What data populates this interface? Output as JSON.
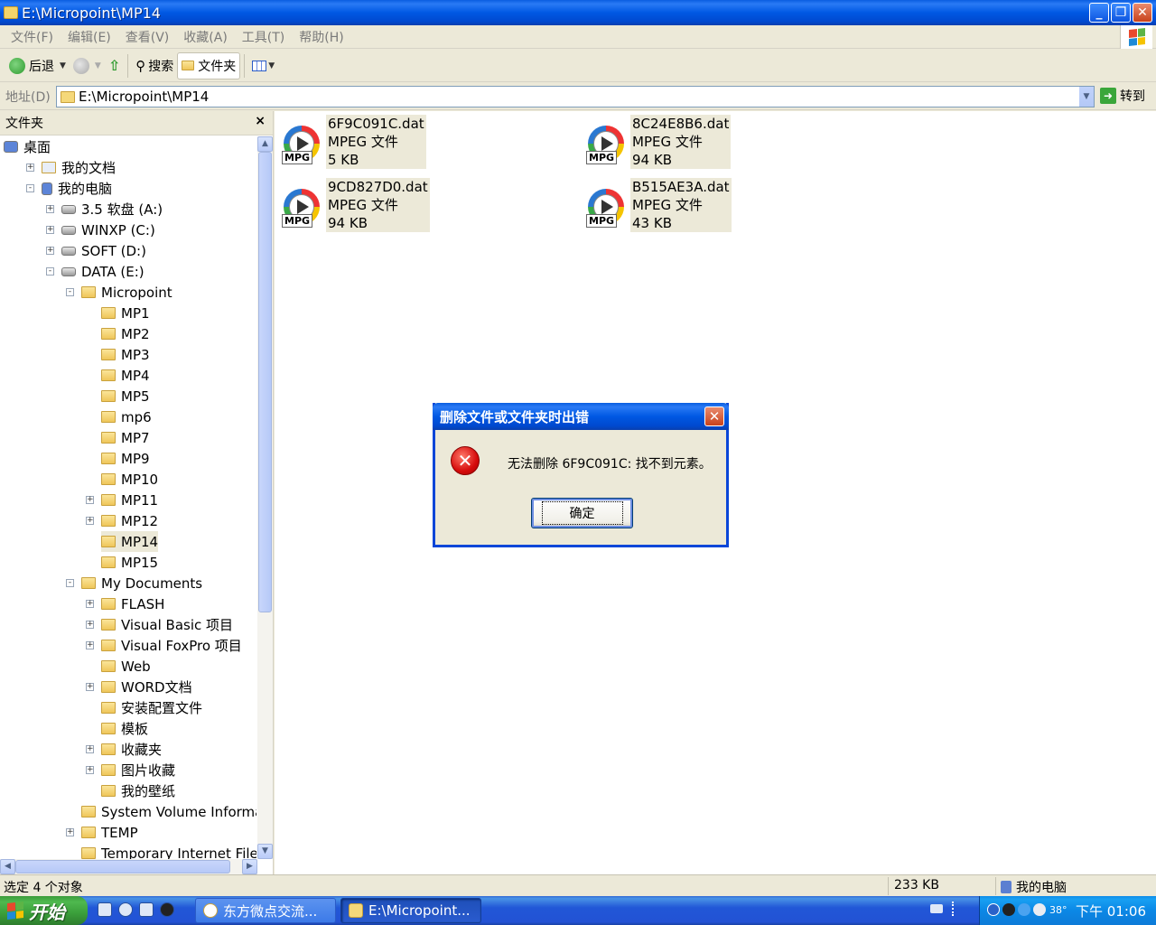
{
  "window": {
    "title": "E:\\Micropoint\\MP14",
    "controls": {
      "minimize": "_",
      "maximize": "❐",
      "close": "✕"
    }
  },
  "menu": [
    "文件(F)",
    "编辑(E)",
    "查看(V)",
    "收藏(A)",
    "工具(T)",
    "帮助(H)"
  ],
  "toolbar": {
    "back_label": "后退",
    "search_label": "搜索",
    "folders_label": "文件夹"
  },
  "address": {
    "label": "地址(D)",
    "value": "E:\\Micropoint\\MP14",
    "go_label": "转到"
  },
  "folder_pane": {
    "title": "文件夹",
    "close": "×",
    "tree": [
      {
        "label": "桌面",
        "level": 0,
        "icon": "desktop-icon",
        "expander": ""
      },
      {
        "label": "我的文档",
        "level": 1,
        "icon": "my-documents-icon",
        "expander": "+"
      },
      {
        "label": "我的电脑",
        "level": 1,
        "icon": "my-computer-icon",
        "expander": "-"
      },
      {
        "label": "3.5 软盘 (A:)",
        "level": 2,
        "icon": "floppy-icon",
        "expander": "+"
      },
      {
        "label": "WINXP (C:)",
        "level": 2,
        "icon": "drive-icon",
        "expander": "+"
      },
      {
        "label": "SOFT (D:)",
        "level": 2,
        "icon": "drive-icon",
        "expander": "+"
      },
      {
        "label": "DATA (E:)",
        "level": 2,
        "icon": "drive-icon",
        "expander": "-"
      },
      {
        "label": "Micropoint",
        "level": 3,
        "icon": "folder-icon",
        "expander": "-"
      },
      {
        "label": "MP1",
        "level": 4,
        "icon": "folder-icon",
        "expander": ""
      },
      {
        "label": "MP2",
        "level": 4,
        "icon": "folder-icon",
        "expander": ""
      },
      {
        "label": "MP3",
        "level": 4,
        "icon": "folder-icon",
        "expander": ""
      },
      {
        "label": "MP4",
        "level": 4,
        "icon": "folder-icon",
        "expander": ""
      },
      {
        "label": "MP5",
        "level": 4,
        "icon": "folder-icon",
        "expander": ""
      },
      {
        "label": "mp6",
        "level": 4,
        "icon": "folder-icon",
        "expander": ""
      },
      {
        "label": "MP7",
        "level": 4,
        "icon": "folder-icon",
        "expander": ""
      },
      {
        "label": "MP9",
        "level": 4,
        "icon": "folder-icon",
        "expander": ""
      },
      {
        "label": "MP10",
        "level": 4,
        "icon": "folder-icon",
        "expander": ""
      },
      {
        "label": "MP11",
        "level": 4,
        "icon": "folder-icon",
        "expander": "+"
      },
      {
        "label": "MP12",
        "level": 4,
        "icon": "folder-icon",
        "expander": "+"
      },
      {
        "label": "MP14",
        "level": 4,
        "icon": "folder-open-icon",
        "expander": "",
        "selected": true
      },
      {
        "label": "MP15",
        "level": 4,
        "icon": "folder-icon",
        "expander": ""
      },
      {
        "label": "My Documents",
        "level": 3,
        "icon": "folder-icon",
        "expander": "-"
      },
      {
        "label": "FLASH",
        "level": 4,
        "icon": "folder-icon",
        "expander": "+"
      },
      {
        "label": "Visual Basic 项目",
        "level": 4,
        "icon": "folder-icon",
        "expander": "+"
      },
      {
        "label": "Visual FoxPro 项目",
        "level": 4,
        "icon": "folder-icon",
        "expander": "+"
      },
      {
        "label": "Web",
        "level": 4,
        "icon": "folder-icon",
        "expander": ""
      },
      {
        "label": "WORD文档",
        "level": 4,
        "icon": "folder-icon",
        "expander": "+"
      },
      {
        "label": "安装配置文件",
        "level": 4,
        "icon": "folder-icon",
        "expander": ""
      },
      {
        "label": "模板",
        "level": 4,
        "icon": "folder-icon",
        "expander": ""
      },
      {
        "label": "收藏夹",
        "level": 4,
        "icon": "folder-icon",
        "expander": "+"
      },
      {
        "label": "图片收藏",
        "level": 4,
        "icon": "picture-folder-icon",
        "expander": "+"
      },
      {
        "label": "我的壁纸",
        "level": 4,
        "icon": "folder-icon",
        "expander": ""
      },
      {
        "label": "System Volume Informatio",
        "level": 3,
        "icon": "folder-icon",
        "expander": ""
      },
      {
        "label": "TEMP",
        "level": 3,
        "icon": "folder-icon",
        "expander": "+"
      },
      {
        "label": "Temporary Internet Files",
        "level": 3,
        "icon": "folder-icon",
        "expander": ""
      }
    ]
  },
  "files": [
    {
      "name": "6F9C091C.dat",
      "type": "MPEG 文件",
      "size": "5 KB",
      "icon": "mpg-icon",
      "icon_label": "MPG"
    },
    {
      "name": "8C24E8B6.dat",
      "type": "MPEG 文件",
      "size": "94 KB",
      "icon": "mpg-icon",
      "icon_label": "MPG"
    },
    {
      "name": "9CD827D0.dat",
      "type": "MPEG 文件",
      "size": "94 KB",
      "icon": "mpg-icon",
      "icon_label": "MPG"
    },
    {
      "name": "B515AE3A.dat",
      "type": "MPEG 文件",
      "size": "43 KB",
      "icon": "mpg-icon",
      "icon_label": "MPG"
    }
  ],
  "dialog": {
    "title": "删除文件或文件夹时出错",
    "message": "无法删除 6F9C091C: 找不到元素。",
    "ok_label": "确定",
    "close": "✕",
    "icon": "error-icon",
    "icon_glyph": "✕"
  },
  "statusbar": {
    "selection": "选定 4 个对象",
    "size": "233 KB",
    "zone": "我的电脑"
  },
  "taskbar": {
    "start_label": "开始",
    "tasks": [
      {
        "label": "东方微点交流...",
        "active": false
      },
      {
        "label": "E:\\Micropoint...",
        "active": true
      }
    ],
    "tray_temp": "38°",
    "clock": "下午 01:06"
  },
  "colors": {
    "titlebar": "#0058e3",
    "selection_bg": "#ece9d8",
    "error_red": "#d60c0c",
    "start_green": "#3a9e3a"
  }
}
